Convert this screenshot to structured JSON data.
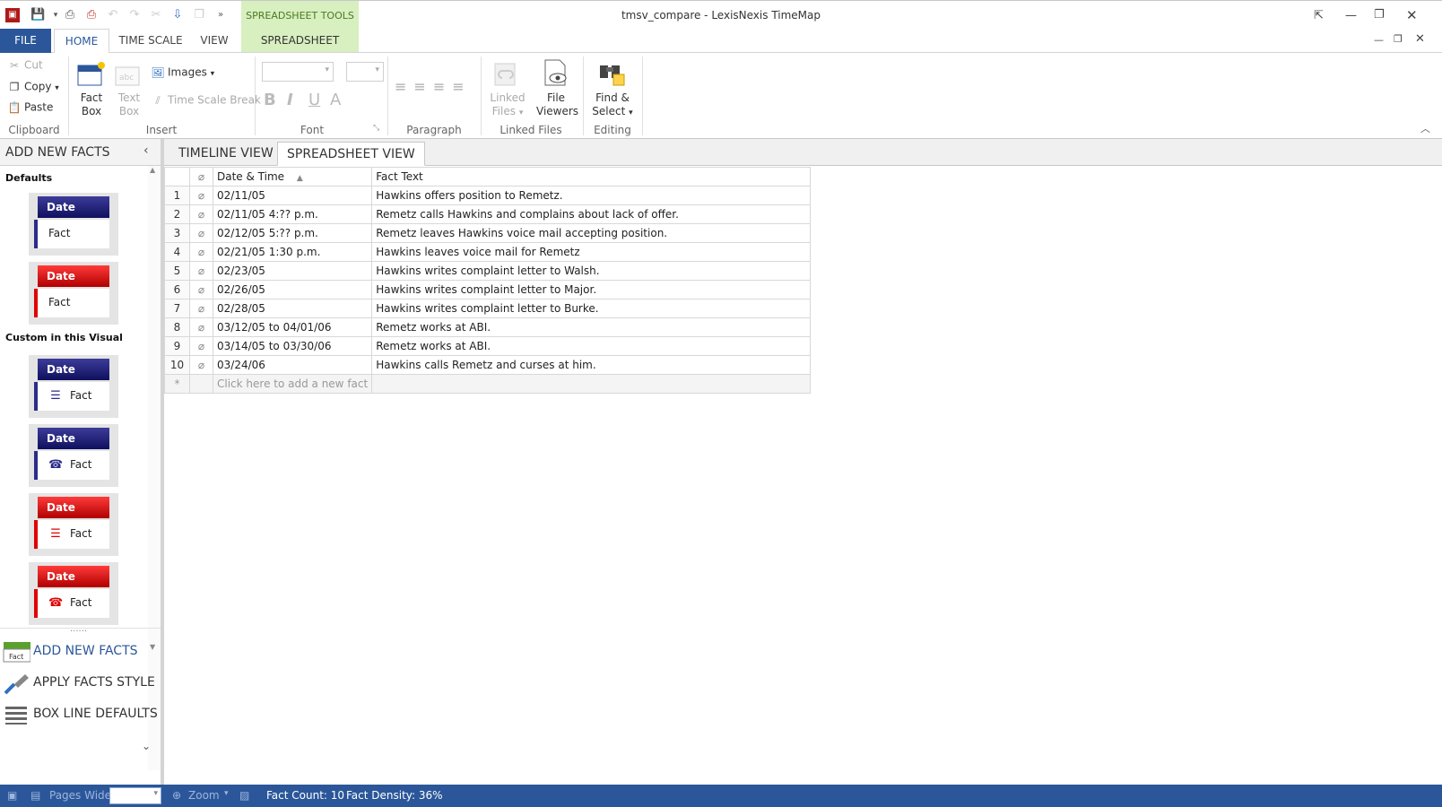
{
  "window": {
    "title": "tmsv_compare - LexisNexis TimeMap",
    "context_tools_label": "SPREADSHEET TOOLS"
  },
  "ribbon_tabs": {
    "file": "FILE",
    "home": "HOME",
    "time_scale": "TIME SCALE",
    "view": "VIEW",
    "spreadsheet": "SPREADSHEET"
  },
  "ribbon": {
    "clipboard": {
      "cut": "Cut",
      "copy": "Copy",
      "paste": "Paste",
      "label": "Clipboard"
    },
    "insert": {
      "fact_box_1": "Fact",
      "fact_box_2": "Box",
      "text_box_1": "Text",
      "text_box_2": "Box",
      "images": "Images",
      "time_scale_break": "Time Scale Break",
      "label": "Insert"
    },
    "font": {
      "bold": "B",
      "italic": "I",
      "underline": "U",
      "font_color": "A",
      "label": "Font"
    },
    "paragraph": {
      "label": "Paragraph"
    },
    "linked_files": {
      "linked_1": "Linked",
      "linked_2": "Files",
      "viewers_1": "File",
      "viewers_2": "Viewers",
      "label": "Linked Files"
    },
    "editing": {
      "find_1": "Find &",
      "find_2": "Select",
      "label": "Editing"
    }
  },
  "left_panel": {
    "title": "ADD NEW FACTS",
    "defaults_label": "Defaults",
    "custom_label": "Custom in this Visual",
    "date_text": "Date",
    "fact_text": "Fact",
    "boxes": [
      {
        "header_color": "#1c1c6e",
        "border_color": "#2b2b8a",
        "icon": ""
      },
      {
        "header_color": "#cc0000",
        "border_color": "#e00000",
        "icon": ""
      },
      {
        "header_color": "#1c1c6e",
        "border_color": "#2b2b8a",
        "icon": "note-icon"
      },
      {
        "header_color": "#1c1c6e",
        "border_color": "#2b2b8a",
        "icon": "phone-icon"
      },
      {
        "header_color": "#cc0000",
        "border_color": "#e00000",
        "icon": "note-icon"
      },
      {
        "header_color": "#cc0000",
        "border_color": "#e00000",
        "icon": "phone-icon"
      }
    ],
    "nav": {
      "add_new_facts": "ADD NEW FACTS",
      "add_new_facts_icon_text": "Fact",
      "apply_facts_style": "APPLY FACTS STYLE",
      "box_line_defaults": "BOX LINE DEFAULTS"
    }
  },
  "view_tabs": {
    "timeline": "TIMELINE VIEW",
    "spreadsheet": "SPREADSHEET VIEW"
  },
  "grid": {
    "col_datetime": "Date & Time",
    "col_facttext": "Fact Text",
    "rows": [
      {
        "n": "1",
        "date": "02/11/05",
        "text": "Hawkins offers position to Remetz."
      },
      {
        "n": "2",
        "date": "02/11/05 4:?? p.m.",
        "text": "Remetz calls Hawkins and complains about lack of offer."
      },
      {
        "n": "3",
        "date": "02/12/05 5:?? p.m.",
        "text": "Remetz leaves Hawkins voice mail accepting position."
      },
      {
        "n": "4",
        "date": "02/21/05 1:30 p.m.",
        "text": "Hawkins leaves voice mail for Remetz"
      },
      {
        "n": "5",
        "date": "02/23/05",
        "text": "Hawkins writes complaint letter to Walsh."
      },
      {
        "n": "6",
        "date": "02/26/05",
        "text": "Hawkins writes complaint letter to Major."
      },
      {
        "n": "7",
        "date": "02/28/05",
        "text": "Hawkins writes complaint letter to Burke."
      },
      {
        "n": "8",
        "date": "03/12/05 to 04/01/06",
        "text": "Remetz works at ABI."
      },
      {
        "n": "9",
        "date": "03/14/05 to 03/30/06",
        "text": "Remetz works at ABI."
      },
      {
        "n": "10",
        "date": "03/24/06",
        "text": "Hawkins calls Remetz and curses at him."
      }
    ],
    "new_row_marker": "*",
    "new_row_prompt": "Click here to add a new fact"
  },
  "status": {
    "pages_wide": "Pages Wide",
    "zoom": "Zoom",
    "fact_count": "Fact Count: 10",
    "fact_density": "Fact Density: 36%"
  },
  "colors": {
    "accent": "#2b579a",
    "context_tab": "#d8efc0"
  }
}
